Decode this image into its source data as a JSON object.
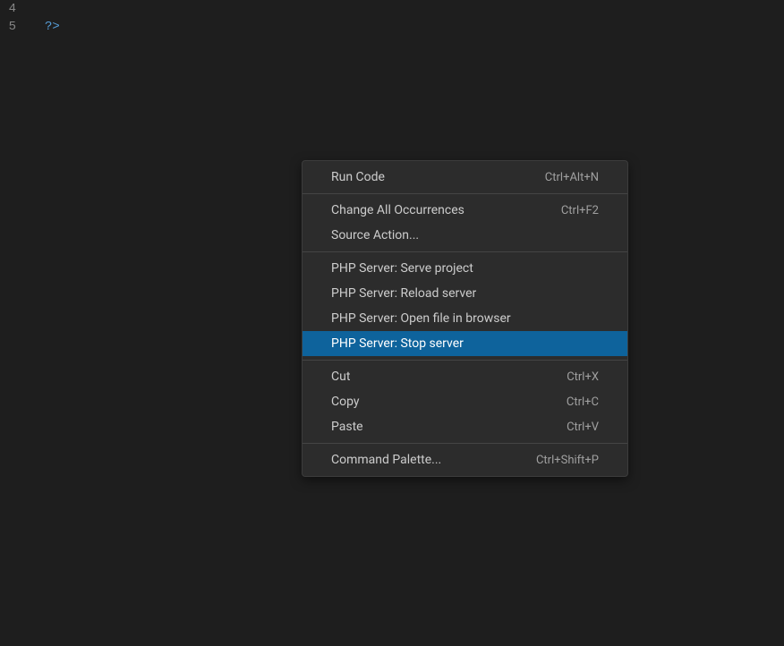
{
  "editor": {
    "lines": [
      {
        "number": "4",
        "content": ""
      },
      {
        "number": "5",
        "content": "?>"
      }
    ]
  },
  "contextMenu": {
    "groups": [
      [
        {
          "label": "Run Code",
          "shortcut": "Ctrl+Alt+N",
          "highlighted": false
        }
      ],
      [
        {
          "label": "Change All Occurrences",
          "shortcut": "Ctrl+F2",
          "highlighted": false
        },
        {
          "label": "Source Action...",
          "shortcut": "",
          "highlighted": false
        }
      ],
      [
        {
          "label": "PHP Server: Serve project",
          "shortcut": "",
          "highlighted": false
        },
        {
          "label": "PHP Server: Reload server",
          "shortcut": "",
          "highlighted": false
        },
        {
          "label": "PHP Server: Open file in browser",
          "shortcut": "",
          "highlighted": false
        },
        {
          "label": "PHP Server: Stop server",
          "shortcut": "",
          "highlighted": true
        }
      ],
      [
        {
          "label": "Cut",
          "shortcut": "Ctrl+X",
          "highlighted": false
        },
        {
          "label": "Copy",
          "shortcut": "Ctrl+C",
          "highlighted": false
        },
        {
          "label": "Paste",
          "shortcut": "Ctrl+V",
          "highlighted": false
        }
      ],
      [
        {
          "label": "Command Palette...",
          "shortcut": "Ctrl+Shift+P",
          "highlighted": false
        }
      ]
    ]
  }
}
